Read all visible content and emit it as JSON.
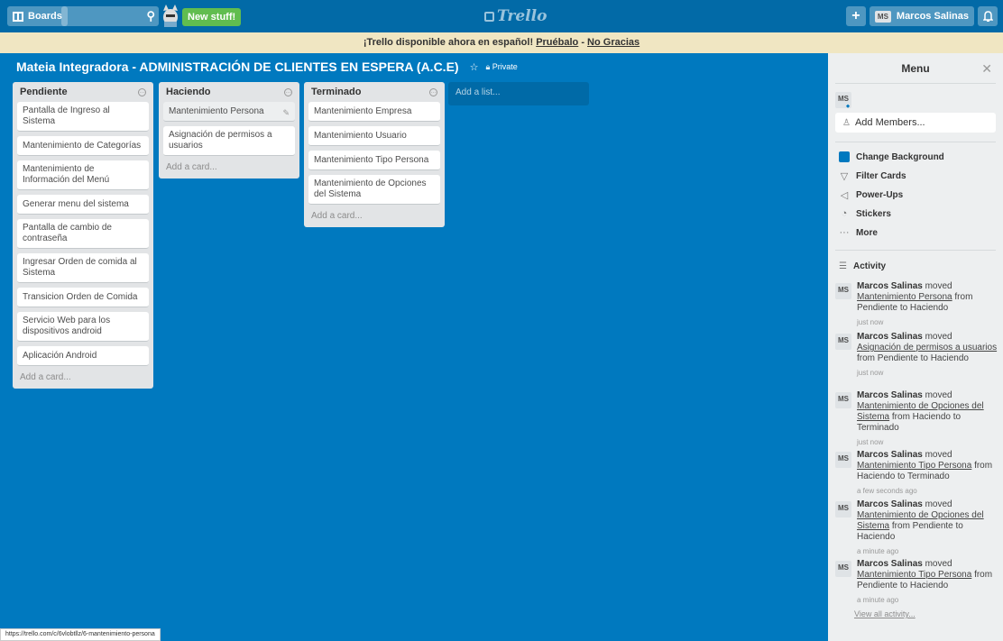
{
  "header": {
    "boards_label": "Boards",
    "new_stuff": "New stuff!",
    "logo": "Trello",
    "user_initials": "MS",
    "user_name": "Marcos Salinas"
  },
  "banner": {
    "text": "¡Trello disponible ahora en español!",
    "try_link": "Pruébalo",
    "sep": " - ",
    "dismiss_link": "No Gracias"
  },
  "board": {
    "title": "Mateia Integradora - ADMINISTRACIÓN DE CLIENTES EN ESPERA (A.C.E)",
    "visibility": "Private"
  },
  "lists": [
    {
      "title": "Pendiente",
      "cards": [
        "Pantalla de Ingreso al Sistema",
        "Mantenimiento de Categorías",
        "Mantenimiento de Información del Menú",
        "Generar menu del sistema",
        "Pantalla de cambio de contraseña",
        "Ingresar Orden de comida al Sistema",
        "Transicion Orden de Comida",
        "Servicio Web para los dispositivos android",
        "Aplicación Android"
      ],
      "add_card": "Add a card..."
    },
    {
      "title": "Haciendo",
      "cards": [
        "Mantenimiento Persona",
        "Asignación de permisos a usuarios"
      ],
      "add_card": "Add a card..."
    },
    {
      "title": "Terminado",
      "cards": [
        "Mantenimiento Empresa",
        "Mantenimiento Usuario",
        "Mantenimiento Tipo Persona",
        "Mantenimiento de Opciones del Sistema"
      ],
      "add_card": "Add a card..."
    }
  ],
  "add_list": "Add a list...",
  "sidebar": {
    "title": "Menu",
    "member_initials": "MS",
    "add_members": "Add Members...",
    "items": [
      "Change Background",
      "Filter Cards",
      "Power-Ups",
      "Stickers",
      "More"
    ],
    "activity_title": "Activity",
    "activity": [
      {
        "user": "Marcos Salinas",
        "verb": "moved",
        "card": "Mantenimiento Persona",
        "rest": "from Pendiente to Haciendo",
        "time": "just now"
      },
      {
        "user": "Marcos Salinas",
        "verb": "moved",
        "card": "Asignación de permisos a usuarios",
        "rest": "from Pendiente to Haciendo",
        "time": "just now"
      },
      {
        "user": "Marcos Salinas",
        "verb": "moved",
        "card": "Mantenimiento de Opciones del Sistema",
        "rest": "from Haciendo to Terminado",
        "time": "just now"
      },
      {
        "user": "Marcos Salinas",
        "verb": "moved",
        "card": "Mantenimiento Tipo Persona",
        "rest": "from Haciendo to Terminado",
        "time": "a few seconds ago"
      },
      {
        "user": "Marcos Salinas",
        "verb": "moved",
        "card": "Mantenimiento de Opciones del Sistema",
        "rest": "from Pendiente to Haciendo",
        "time": "a minute ago"
      },
      {
        "user": "Marcos Salinas",
        "verb": "moved",
        "card": "Mantenimiento Tipo Persona",
        "rest": "from Pendiente to Haciendo",
        "time": "a minute ago"
      }
    ],
    "view_all": "View all activity..."
  },
  "status_url": "https://trello.com/c/6vlobtllz/6-mantenimiento-persona",
  "colors": {
    "board_bg": "#0079bf",
    "header_bg": "#026aa7",
    "banner_bg": "#f0e6c2",
    "new_stuff": "#61bd4f"
  }
}
